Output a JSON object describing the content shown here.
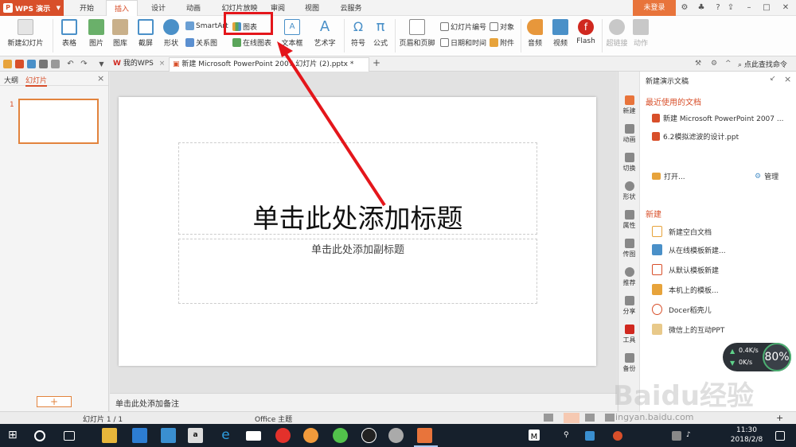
{
  "app": {
    "name": "WPS 演示",
    "login": "未登录"
  },
  "menu_tabs": [
    "开始",
    "插入",
    "设计",
    "动画",
    "幻灯片放映",
    "审阅",
    "视图",
    "云服务"
  ],
  "active_menu": "插入",
  "ribbon": {
    "new_slide": "新建幻灯片",
    "table": "表格",
    "picture": "图片",
    "gallery": "图库",
    "screenshot": "截屏",
    "shape": "形状",
    "smartart": "SmartArt",
    "chart": "图表",
    "relation_chart": "关系图",
    "online_chart": "在线图表",
    "textbox": "文本框",
    "wordart": "艺术字",
    "symbol": "符号",
    "formula": "公式",
    "header_footer": "页眉和页脚",
    "slide_number": "幻灯片编号",
    "datetime": "日期和时间",
    "object": "对象",
    "attachment": "附件",
    "audio": "音频",
    "video": "视频",
    "flash": "Flash",
    "hyperlink": "超链接",
    "action": "动作",
    "search_commands": "点此查找命令"
  },
  "doc_tabs": [
    {
      "label": "我的WPS"
    },
    {
      "label": "新建 Microsoft PowerPoint 2007 幻灯片 (2).pptx *"
    }
  ],
  "left_panel": {
    "tab_outline": "大纲",
    "tab_slides": "幻灯片",
    "slide_number": "1",
    "add_button": "+"
  },
  "slide": {
    "title": "单击此处添加标题",
    "subtitle": "单击此处添加副标题"
  },
  "notes": "单击此处添加备注",
  "right_panel": {
    "header": "新建演示文稿",
    "tabs": [
      "新建",
      "动画",
      "切换",
      "形状",
      "属性",
      "传图",
      "推荐",
      "分享",
      "工具",
      "备份"
    ],
    "recent_title": "最近使用的文档",
    "recent_docs": [
      "新建 Microsoft PowerPoint 2007 ...",
      "6.2模拟滤波的设计.ppt"
    ],
    "open": "打开...",
    "manage": "管理",
    "new_title": "新建",
    "new_items": [
      "新建空白文档",
      "从在线模板新建...",
      "从默认模板新建",
      "本机上的模板...",
      "Docer稻壳儿",
      "微信上的互动PPT"
    ]
  },
  "speed_widget": {
    "up": "0.4K/s",
    "down": "0K/s",
    "percent": "80%"
  },
  "status": {
    "slide": "幻灯片 1 / 1",
    "theme": "Office 主题"
  },
  "taskbar": {
    "time": "11:30",
    "date": "2018/2/8"
  },
  "watermark": {
    "text": "Baidu经验",
    "url": "jingyan.baidu.com"
  },
  "colors": {
    "accent": "#d84f2a",
    "highlight": "#e4161b"
  }
}
